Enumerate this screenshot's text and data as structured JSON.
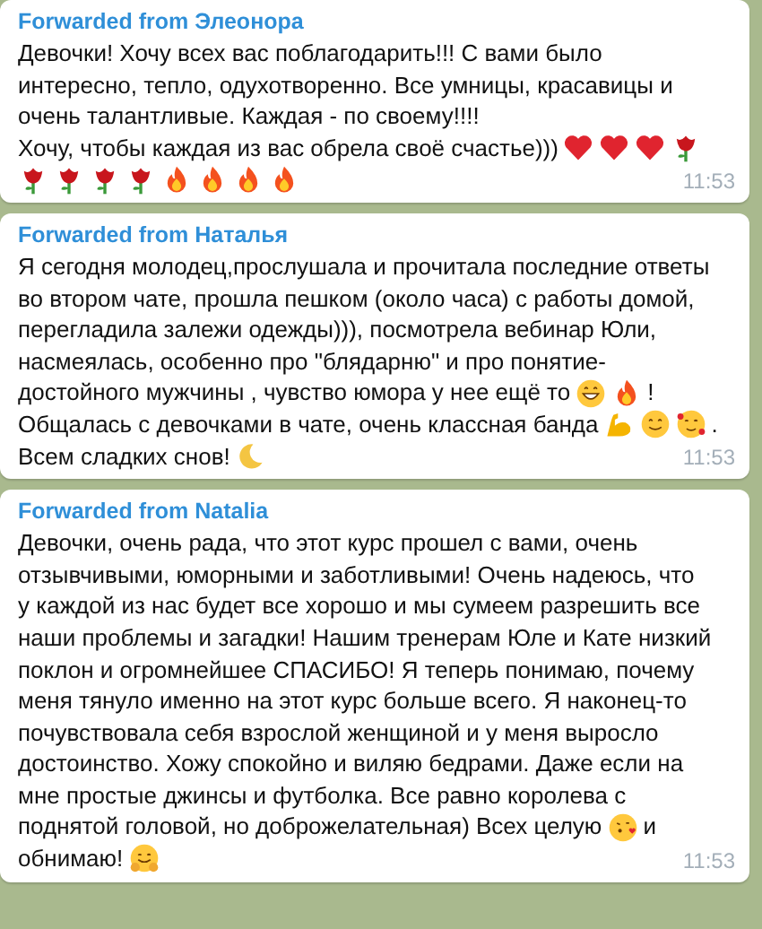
{
  "messages": [
    {
      "sender": "Forwarded from Элеонора",
      "lines": [
        {
          "parts": [
            {
              "kind": "text",
              "text": "Девочки! Хочу всех вас поблагодарить!!! С вами было"
            }
          ]
        },
        {
          "parts": [
            {
              "kind": "text",
              "text": "интересно, тепло, одухотворенно. Все умницы, красавицы и"
            }
          ]
        },
        {
          "parts": [
            {
              "kind": "text",
              "text": "очень талантливые. Каждая - по своему!!!!"
            }
          ]
        },
        {
          "parts": [
            {
              "kind": "text",
              "text": "Хочу, чтобы каждая из вас обрела своё счастье)))"
            },
            {
              "kind": "heart"
            },
            {
              "kind": "heart"
            },
            {
              "kind": "heart"
            },
            {
              "kind": "rose"
            }
          ]
        },
        {
          "parts": [
            {
              "kind": "rose"
            },
            {
              "kind": "rose"
            },
            {
              "kind": "rose"
            },
            {
              "kind": "rose"
            },
            {
              "kind": "fire"
            },
            {
              "kind": "fire"
            },
            {
              "kind": "fire"
            },
            {
              "kind": "fire"
            }
          ]
        }
      ],
      "time": "11:53"
    },
    {
      "sender": "Forwarded from Наталья",
      "lines": [
        {
          "parts": [
            {
              "kind": "text",
              "text": "Я сегодня молодец,прослушала и прочитала последние ответы"
            }
          ]
        },
        {
          "parts": [
            {
              "kind": "text",
              "text": "во втором чате, прошла пешком (около часа) с работы домой,"
            }
          ]
        },
        {
          "parts": [
            {
              "kind": "text",
              "text": "перегладила залежи одежды))), посмотрела вебинар Юли,"
            }
          ]
        },
        {
          "parts": [
            {
              "kind": "text",
              "text": "насмеялась, особенно про \"блядарню\" и про понятие-"
            }
          ]
        },
        {
          "parts": [
            {
              "kind": "text",
              "text": "достойного мужчины , чувство юмора у нее ещё то"
            },
            {
              "kind": "grin"
            },
            {
              "kind": "fire"
            },
            {
              "kind": "text",
              "text": "!"
            }
          ]
        },
        {
          "parts": [
            {
              "kind": "text",
              "text": "Общалась с девочками в чате, очень классная банда"
            },
            {
              "kind": "muscle"
            },
            {
              "kind": "smile"
            },
            {
              "kind": "love"
            },
            {
              "kind": "text",
              "text": "."
            }
          ]
        },
        {
          "parts": [
            {
              "kind": "text",
              "text": "Всем сладких снов!"
            },
            {
              "kind": "moon"
            }
          ]
        }
      ],
      "time": "11:53"
    },
    {
      "sender": "Forwarded from Natalia",
      "lines": [
        {
          "parts": [
            {
              "kind": "text",
              "text": "Девочки, очень рада, что этот курс прошел с вами, очень"
            }
          ]
        },
        {
          "parts": [
            {
              "kind": "text",
              "text": "отзывчивыми, юморными и заботливыми! Очень надеюсь, что"
            }
          ]
        },
        {
          "parts": [
            {
              "kind": "text",
              "text": "у каждой из нас будет все хорошо и мы сумеем разрешить все"
            }
          ]
        },
        {
          "parts": [
            {
              "kind": "text",
              "text": "наши проблемы и загадки! Нашим тренерам Юле и Кате низкий"
            }
          ]
        },
        {
          "parts": [
            {
              "kind": "text",
              "text": "поклон и огромнейшее СПАСИБО! Я теперь понимаю, почему"
            }
          ]
        },
        {
          "parts": [
            {
              "kind": "text",
              "text": "меня тянуло именно на этот курс больше всего. Я наконец-то"
            }
          ]
        },
        {
          "parts": [
            {
              "kind": "text",
              "text": "почувствовала себя взрослой женщиной и у меня выросло"
            }
          ]
        },
        {
          "parts": [
            {
              "kind": "text",
              "text": "достоинство. Хожу спокойно и виляю бедрами. Даже если на"
            }
          ]
        },
        {
          "parts": [
            {
              "kind": "text",
              "text": "мне простые джинсы и футболка. Все равно королева с"
            }
          ]
        },
        {
          "parts": [
            {
              "kind": "text",
              "text": "поднятой головой, но доброжелательная) Всех целую"
            },
            {
              "kind": "kiss"
            },
            {
              "kind": "text",
              "text": "и"
            }
          ]
        },
        {
          "parts": [
            {
              "kind": "text",
              "text": "обнимаю!"
            },
            {
              "kind": "hug"
            }
          ]
        }
      ],
      "time": "11:53"
    }
  ]
}
